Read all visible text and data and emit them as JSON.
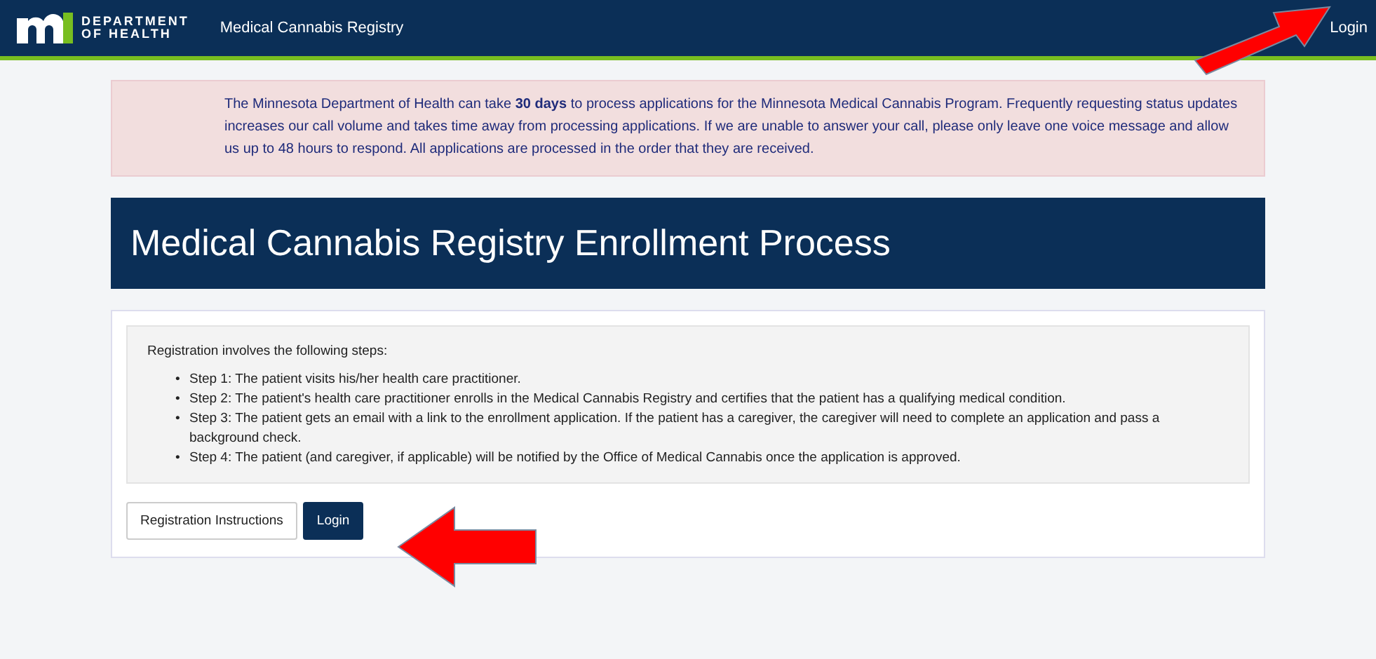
{
  "header": {
    "logo_line_1": "DEPARTMENT",
    "logo_line_2": "OF HEALTH",
    "site_title": "Medical Cannabis Registry",
    "login_link": "Login"
  },
  "notice": "The Minnesota Department of Health can take **30 days** to process applications for the Minnesota Medical Cannabis Program. Frequently requesting status updates increases our call volume and takes time away from processing applications. If we are unable to answer your call, please only leave one voice message and allow us up to 48 hours to respond. All applications are processed in the order that they are received.",
  "page_title": "Medical Cannabis Registry Enrollment Process",
  "intro": "Registration involves the following steps:",
  "steps": [
    {
      "bullet": "•",
      "text": "Step 1: The patient visits his/her health care practitioner."
    },
    {
      "bullet": "•",
      "text": "Step 2: The patient's health care practitioner enrolls in the Medical Cannabis Registry and certifies that the patient has a qualifying medical condition."
    },
    {
      "bullet": "•",
      "text": "Step 3: The patient gets an email with a link to the enrollment application. If the patient has a caregiver, the caregiver will need to complete an application and pass a background check."
    },
    {
      "bullet": "•",
      "text": "Step 4: The patient (and caregiver, if applicable) will be notified by the Office of Medical Cannabis once the application is approved."
    }
  ],
  "buttons": [
    {
      "label": "Registration Instructions",
      "kind": "default"
    },
    {
      "label": "Login",
      "kind": "primary"
    }
  ]
}
